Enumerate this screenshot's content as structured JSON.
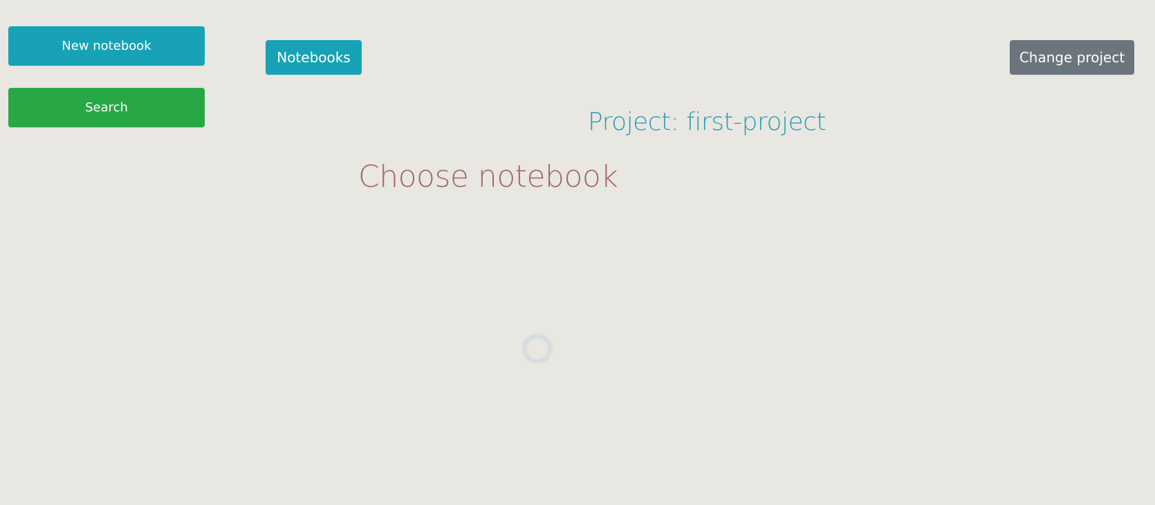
{
  "sidebar": {
    "new_notebook_label": "New notebook",
    "search_label": "Search"
  },
  "header": {
    "notebooks_label": "Notebooks",
    "change_project_label": "Change project"
  },
  "main": {
    "project_title": "Project: first-project",
    "heading": "Choose notebook",
    "loading_indicator": "spinner-icon"
  },
  "colors": {
    "background": "#e8e7e2",
    "info": "#17a2b8",
    "success": "#28a745",
    "secondary": "#6c757d",
    "project_title": "#2b9db4",
    "heading": "#a5676a"
  }
}
